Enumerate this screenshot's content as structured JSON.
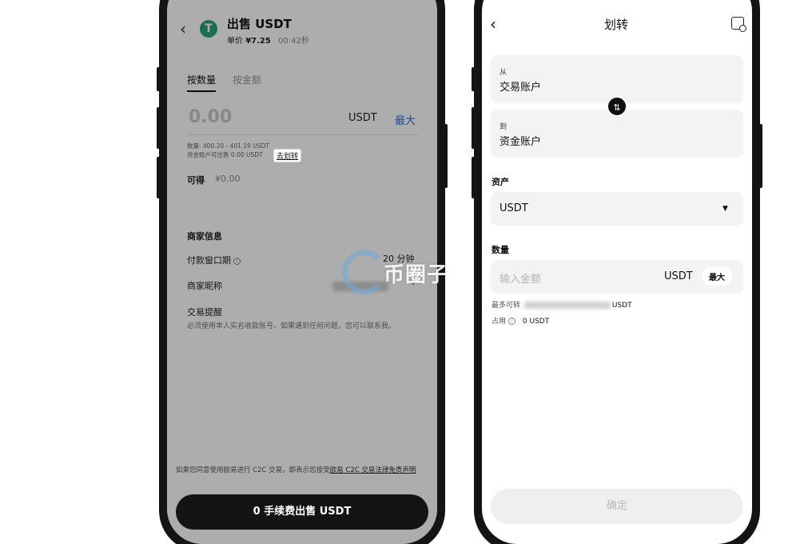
{
  "left_screen": {
    "header": {
      "back_icon": "chevron-left-icon",
      "coin_logo": "T",
      "title": "出售 USDT",
      "price_label": "单价",
      "price_value": "¥7.25",
      "timer": "00:42秒"
    },
    "tabs": [
      {
        "label": "按数量",
        "active": true
      },
      {
        "label": "按金额",
        "active": false
      }
    ],
    "amount": {
      "placeholder": "0.00",
      "unit": "USDT",
      "max_label": "最大"
    },
    "limits_text": "数量: 400.20 - 401.19 USDT",
    "available_text": "资金账户可出售 0.00 USDT",
    "transfer_link": "去划转",
    "receive": {
      "label": "可得",
      "value": "¥0.00"
    },
    "merchant": {
      "section_title": "商家信息",
      "payment_window_label": "付款窗口期",
      "payment_window_value": "20 分钟",
      "nickname_label": "商家昵称",
      "reminder_label": "交易提醒",
      "reminder_text": "必须使用本人实名收款账号。如果遇到任何问题，您可以联系我。"
    },
    "footer": {
      "disclaimer_prefix": "如果您同意使用欧易进行 C2C 交易，即表示您接受",
      "disclaimer_link": "欧易 C2C 交易法律免责声明",
      "sell_button": "0 手续费出售 USDT"
    }
  },
  "right_screen": {
    "header": {
      "back_icon": "chevron-left-icon",
      "title": "划转",
      "history_icon": "history-icon"
    },
    "from": {
      "label": "从",
      "value": "交易账户"
    },
    "swap_icon": "swap-arrows-icon",
    "to": {
      "label": "到",
      "value": "资金账户"
    },
    "asset": {
      "section_label": "资产",
      "selected": "USDT"
    },
    "quantity": {
      "section_label": "数量",
      "placeholder": "输入金额",
      "unit": "USDT",
      "max_label": "最大"
    },
    "max_transferable": {
      "label": "最多可转",
      "unit": "USDT"
    },
    "occupied": {
      "label": "占用",
      "value": "0 USDT"
    },
    "confirm_button": "确定"
  },
  "watermark": {
    "text": "币圈子"
  },
  "colors": {
    "tether_green": "#26a17b",
    "link_blue": "#2f6fe0",
    "dark_button": "#141414",
    "overlay": "rgba(0,0,0,0.32)",
    "card_bg": "#f3f3f3"
  }
}
